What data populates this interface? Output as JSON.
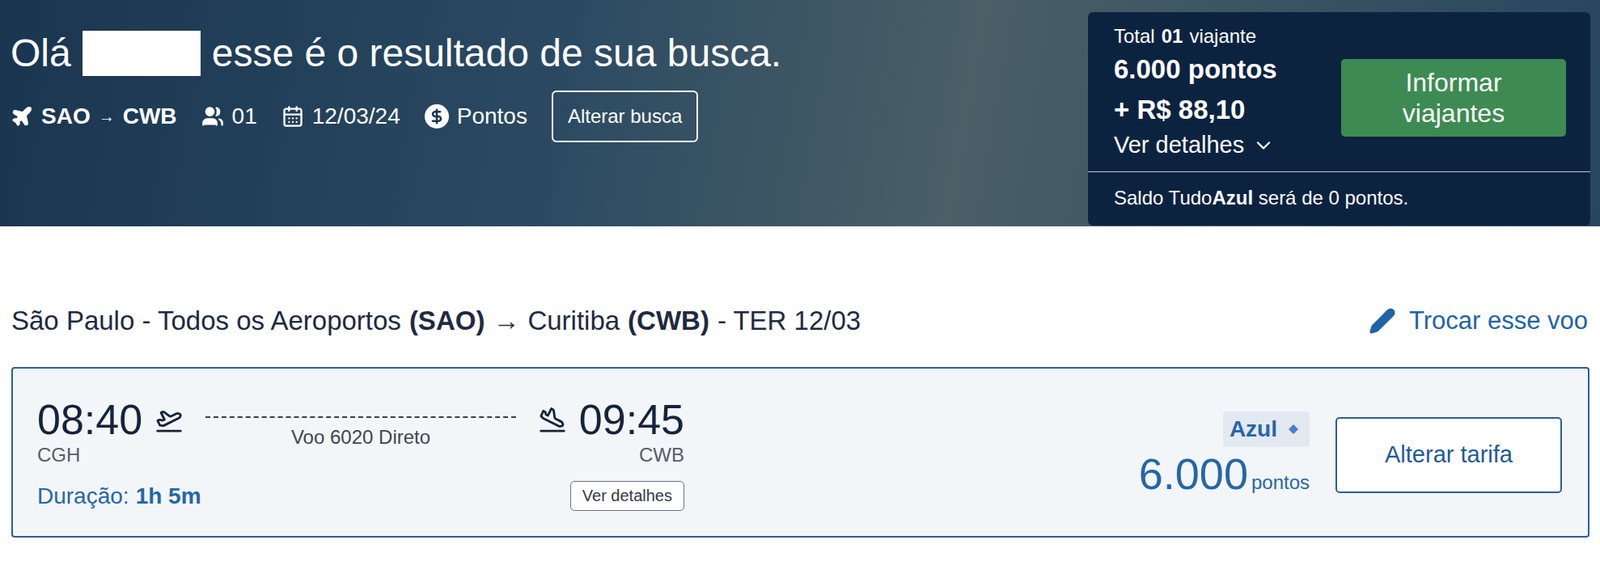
{
  "header": {
    "greeting": "Olá",
    "message": "esse é o resultado de sua busca.",
    "search": {
      "origin": "SAO",
      "arrow": "→",
      "destination": "CWB",
      "passengers": "01",
      "date": "12/03/24",
      "payment": "Pontos",
      "button": "Alterar busca"
    }
  },
  "summary": {
    "total_prefix": "Total",
    "total_count": "01",
    "total_suffix": "viajante",
    "points": "6.000 pontos",
    "cash": "+ R$ 88,10",
    "details": "Ver detalhes",
    "button": "Informar viajantes",
    "balance_prefix": "Saldo Tudo",
    "balance_brand": "Azul",
    "balance_suffix": " será de 0 pontos."
  },
  "route": {
    "origin": "São Paulo - Todos os Aeroportos",
    "origin_code": "(SAO)",
    "arrow": "→",
    "destination": "Curitiba",
    "destination_code": "(CWB)",
    "date": "- TER 12/03",
    "change": "Trocar esse voo"
  },
  "flight": {
    "departure": "08:40",
    "origin": "CGH",
    "arrival": "09:45",
    "destination": "CWB",
    "label": "Voo 6020 Direto",
    "duration_label": "Duração:",
    "duration": "1h 5m",
    "details": "Ver detalhes",
    "fare": "Azul",
    "price": "6.000",
    "unit": "pontos",
    "button": "Alterar tarifa"
  }
}
